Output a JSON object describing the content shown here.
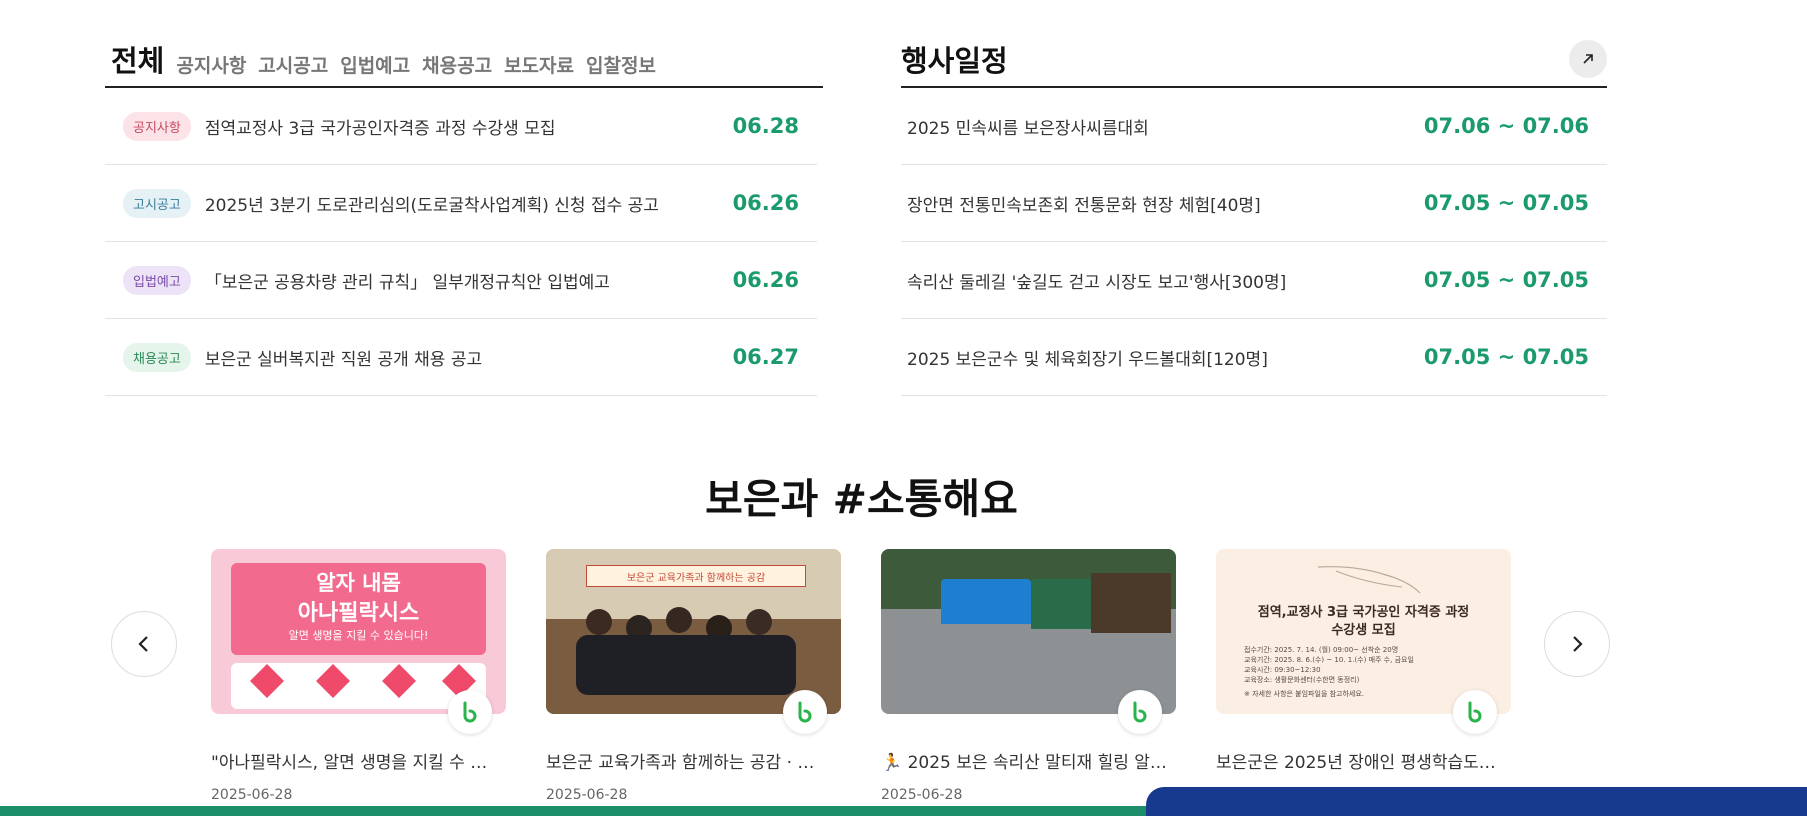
{
  "notice": {
    "main_tab": "전체",
    "tabs": [
      "공지사항",
      "고시공고",
      "입법예고",
      "채용공고",
      "보도자료",
      "입찰정보"
    ],
    "items": [
      {
        "badge": "공지사항",
        "title": "점역교정사 3급 국가공인자격증 과정 수강생 모집",
        "date": "06.28"
      },
      {
        "badge": "고시공고",
        "title": "2025년 3분기 도로관리심의(도로굴착사업계획) 신청 접수 공고",
        "date": "06.26"
      },
      {
        "badge": "입법예고",
        "title": "「보은군 공용차량 관리 규칙」 일부개정규칙안 입법예고",
        "date": "06.26"
      },
      {
        "badge": "채용공고",
        "title": "보은군 실버복지관 직원 공개 채용 공고",
        "date": "06.27"
      }
    ]
  },
  "events": {
    "title": "행사일정",
    "items": [
      {
        "title": "2025 민속씨름 보은장사씨름대회",
        "date": "07.06 ~ 07.06"
      },
      {
        "title": "장안면 전통민속보존회 전통문화 현장 체험[40명]",
        "date": "07.05 ~ 07.05"
      },
      {
        "title": "속리산 둘레길 '숲길도 걷고 시장도 보고'행사[300명]",
        "date": "07.05 ~ 07.05"
      },
      {
        "title": "2025 보은군수 및 체육회장기 우드볼대회[120명]",
        "date": "07.05 ~ 07.05"
      }
    ]
  },
  "social": {
    "title": "보은과 #소통해요",
    "cards": [
      {
        "title": "\"아나필락시스, 알면 생명을 지킬 수 …",
        "date": "2025-06-28",
        "image_text": [
          "알자 내몸",
          "아나필락시스",
          "알면 생명을 지킬 수 있습니다!"
        ]
      },
      {
        "title": "보은군 교육가족과 함께하는 공감 · …",
        "date": "2025-06-28",
        "image_text": [
          "보은군 교육가족과 함께하는 공감"
        ]
      },
      {
        "title": "🏃 2025 보은 속리산 말티재 힐링 알…",
        "date": "2025-06-28",
        "image_text": []
      },
      {
        "title": "보은군은 2025년 장애인 평생학습도…",
        "date": "2025-06-28",
        "image_text": [
          "점역,교정사 3급 국가공인 자격증 과정",
          "수강생 모집",
          "접수기간: 2025. 7. 14. (월) 09:00~ 선착순 20명",
          "교육기간: 2025. 8. 6.(수) ~ 10. 1.(수) 매주 수, 금요일",
          "교육시간: 09:30~12:30",
          "교육장소: 생활문화센터(수한면 동정리)",
          "※ 자세한 사항은 붙임파일을 참고하세요."
        ]
      }
    ]
  },
  "colors": {
    "accent_green": "#1b9a6c",
    "badge_notice": "#fbe3e7",
    "badge_gosi": "#e6f1f6",
    "badge_ipbeop": "#ece3f7",
    "badge_chaeyong": "#e6f5ec",
    "footer_blue": "#173a8e"
  },
  "icons": {
    "more": "arrow-up-right-icon",
    "prev": "chevron-left-icon",
    "next": "chevron-right-icon",
    "blog": "blog-b-icon"
  }
}
